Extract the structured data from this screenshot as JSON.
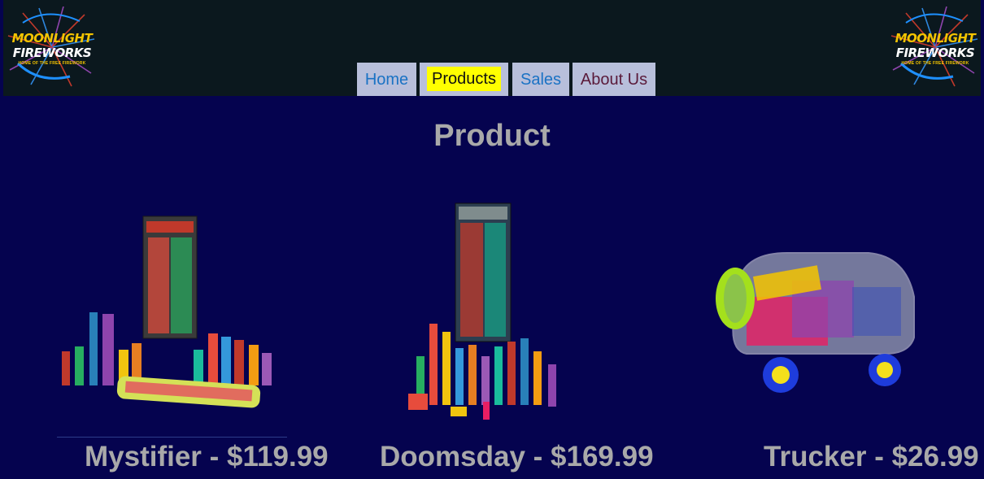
{
  "brand": {
    "line1": "MOONLIGHT",
    "line2": "FIREWORKS",
    "tagline": "HOME OF THE FREE FIREWORK"
  },
  "nav": {
    "home": "Home",
    "products": "Products",
    "sales": "Sales",
    "about": "About Us"
  },
  "page_title": "Product",
  "products": [
    {
      "caption": "Mystifier - $119.99"
    },
    {
      "caption": "Doomsday - $169.99"
    },
    {
      "caption": "Trucker - $26.99"
    }
  ],
  "colors": {
    "page_bg": "#05034f",
    "header_bg": "#0b181e",
    "nav_bg": "#b8bfdb",
    "active_highlight": "#ffff00",
    "text_gray": "#a9a9a9"
  }
}
